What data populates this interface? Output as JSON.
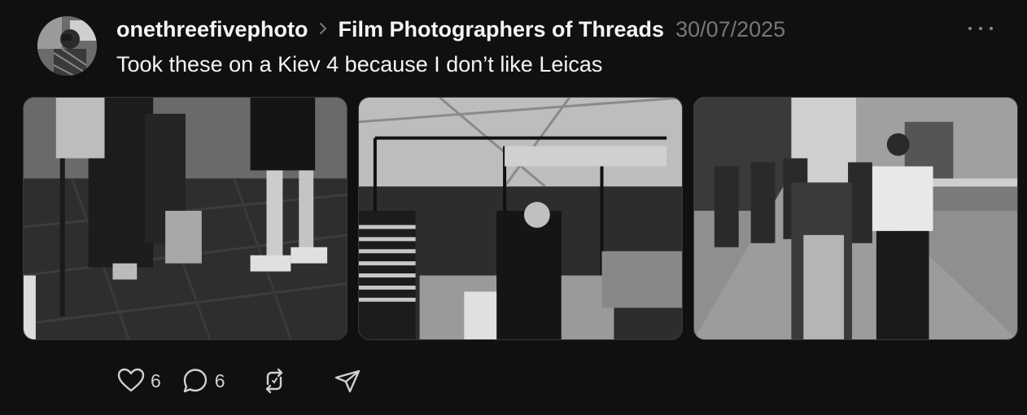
{
  "post": {
    "username": "onethreefivephoto",
    "community": "Film Photographers of Threads",
    "date": "30/07/2025",
    "caption": "Took these on a Kiev 4 because I don’t like Leicas",
    "avatar_icon": "user-avatar-photo",
    "more_icon": "more-horizontal-icon",
    "separator_icon": "chevron-right-icon"
  },
  "photos": [
    {
      "name": "photo-dog-street",
      "description_icon": "photo"
    },
    {
      "name": "photo-market-stalls",
      "description_icon": "photo"
    },
    {
      "name": "photo-couple-walking",
      "description_icon": "photo"
    }
  ],
  "actions": {
    "likes": "6",
    "replies": "6",
    "like_icon": "heart-icon",
    "reply_icon": "comment-icon",
    "repost_icon": "repost-icon",
    "share_icon": "send-icon"
  },
  "colors": {
    "background": "#101010",
    "text": "#f3f5f7",
    "muted": "#777777"
  }
}
